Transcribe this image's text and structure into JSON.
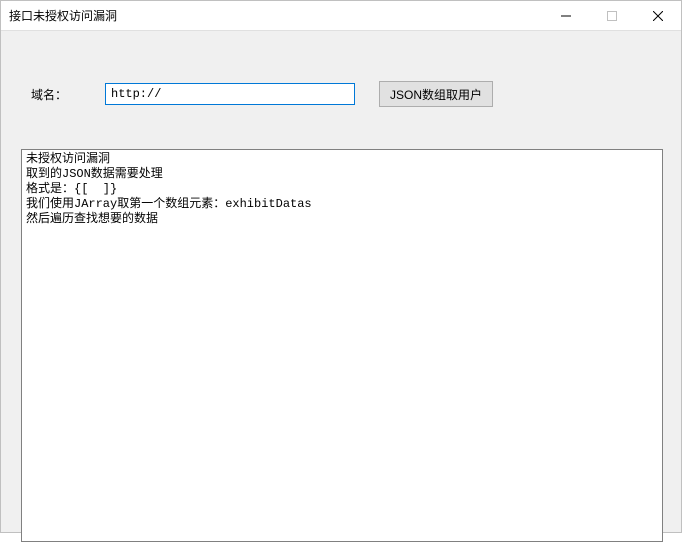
{
  "window": {
    "title": "接口未授权访问漏洞"
  },
  "form": {
    "domain_label": "域名：",
    "domain_value": "http://",
    "submit_label": "JSON数组取用户"
  },
  "output": {
    "lines": [
      "未授权访问漏洞",
      "取到的JSON数据需要处理",
      "格式是：{[  ]}",
      "我们使用JArray取第一个数组元素：exhibitDatas",
      "然后遍历查找想要的数据"
    ]
  }
}
